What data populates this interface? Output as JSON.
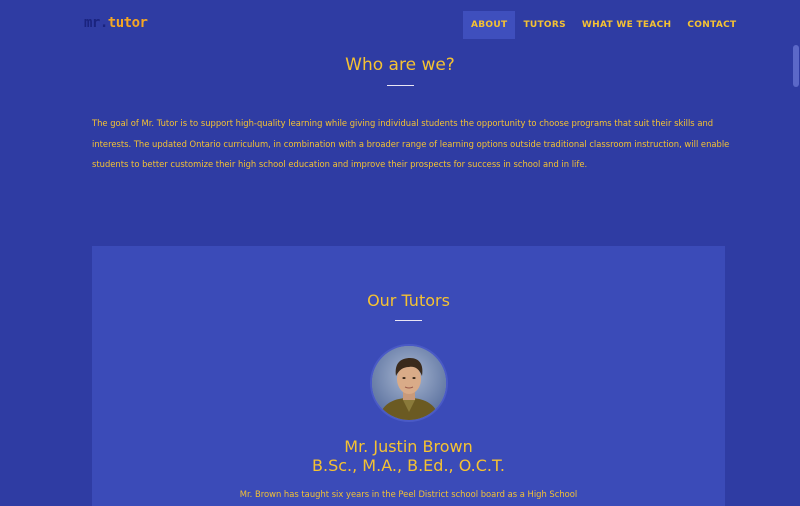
{
  "brand": {
    "logo_mr": "mr.",
    "logo_tutor": "tutor"
  },
  "nav": {
    "items": [
      "ABOUT",
      "TUTORS",
      "WHAT WE TEACH",
      "CONTACT"
    ],
    "active": "ABOUT"
  },
  "about": {
    "title": "Who are we?",
    "body": "The goal of Mr. Tutor is to support high-quality learning while giving individual students the opportunity to choose programs that suit their skills and interests. The updated Ontario curriculum, in combination with a broader range of learning options outside traditional classroom instruction, will enable students to better customize their high school education and improve their prospects for success in school and in life."
  },
  "tutors": {
    "title": "Our Tutors",
    "items": [
      {
        "name": "Mr. Justin Brown",
        "credentials": "B.Sc., M.A., B.Ed., O.C.T.",
        "bio": "Mr. Brown has taught six years in the Peel District school board as a High School"
      }
    ]
  },
  "colors": {
    "background": "#2f3ca3",
    "panel": "#3b4bb8",
    "accent_text": "#f5c232",
    "nav_active": "#3f4fbd"
  }
}
